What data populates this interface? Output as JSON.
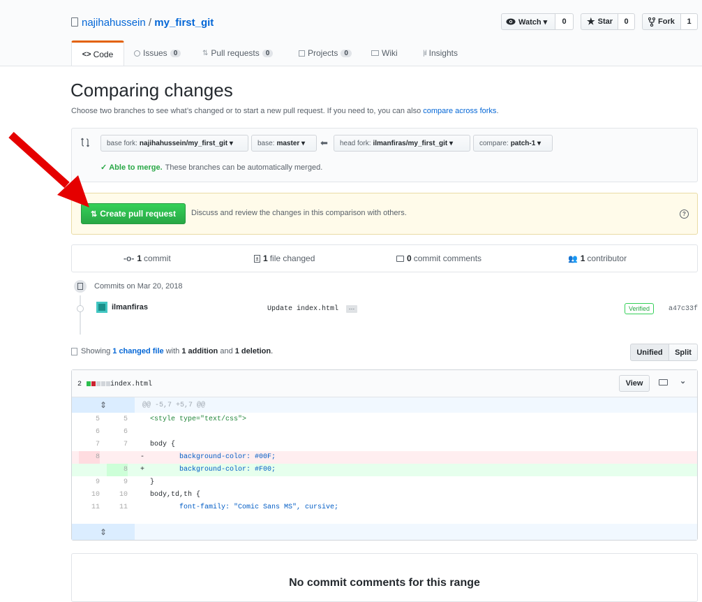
{
  "repo": {
    "owner": "najihahussein",
    "separator": " / ",
    "name": "my_first_git"
  },
  "actions": {
    "watch_label": "Watch ▾",
    "watch_count": "0",
    "star_label": "Star",
    "star_count": "0",
    "fork_label": "Fork",
    "fork_count": "1"
  },
  "tabs": [
    {
      "label": "Code",
      "count": ""
    },
    {
      "label": "Issues",
      "count": "0"
    },
    {
      "label": "Pull requests",
      "count": "0"
    },
    {
      "label": "Projects",
      "count": "0"
    },
    {
      "label": "Wiki",
      "count": ""
    },
    {
      "label": "Insights",
      "count": ""
    }
  ],
  "compare": {
    "title": "Comparing changes",
    "subtitle": "Choose two branches to see what’s changed or to start a new pull request. If you need to, you can also",
    "subtitle_link": "compare across forks",
    "subtitle_end": ".",
    "base_fork_prefix": "base fork:",
    "base_fork_value": "najihahussein/my_first_git ▾",
    "base_prefix": "base:",
    "base_value": "master ▾",
    "head_fork_prefix": "head fork:",
    "head_fork_value": "ilmanfiras/my_first_git ▾",
    "compare_prefix": "compare:",
    "compare_value": "patch-1 ▾",
    "merge_status": "Able to merge.",
    "merge_text": "These branches can be automatically merged.",
    "create_pr_label": "Create pull request",
    "create_pr_desc": "Discuss and review the changes in this comparison with others."
  },
  "summary": {
    "commits_num": "1",
    "commits_label": "commit",
    "files_num": "1",
    "files_label": "file changed",
    "comments_num": "0",
    "comments_label": "commit comments",
    "contrib_num": "1",
    "contrib_label": "contributor"
  },
  "commits": {
    "date_label": "Commits on Mar 20, 2018",
    "author": "ilmanfiras",
    "message": "Update index.html",
    "ellipsis": "…",
    "verified": "Verified",
    "sha": "a47c33f"
  },
  "files": {
    "showing": "Showing",
    "changed_link": "1 changed file",
    "with": "with",
    "additions": "1 addition",
    "and": "and",
    "deletions": "1 deletion",
    "end": ".",
    "unified": "Unified",
    "split": "Split",
    "diff_count": "2",
    "filename": "index.html",
    "view_label": "View",
    "hunk_header": "@@ -5,7 +5,7 @@"
  },
  "diff_lines": [
    {
      "old": "5",
      "new": "5",
      "sign": "",
      "code": " <style type=\"text/css\">",
      "kind": "ctx"
    },
    {
      "old": "6",
      "new": "6",
      "sign": "",
      "code": "",
      "kind": "ctx"
    },
    {
      "old": "7",
      "new": "7",
      "sign": "",
      "code": " body {",
      "kind": "ctx"
    },
    {
      "old": "8",
      "new": "",
      "sign": "-",
      "code": "        background-color: #00F;",
      "kind": "del"
    },
    {
      "old": "",
      "new": "8",
      "sign": "+",
      "code": "        background-color: #F00;",
      "kind": "add"
    },
    {
      "old": "9",
      "new": "9",
      "sign": "",
      "code": " }",
      "kind": "ctx"
    },
    {
      "old": "10",
      "new": "10",
      "sign": "",
      "code": " body,td,th {",
      "kind": "ctx"
    },
    {
      "old": "11",
      "new": "11",
      "sign": "",
      "code": "        font-family: \"Comic Sans MS\", cursive;",
      "kind": "ctx"
    }
  ],
  "comments_empty": "No commit comments for this range",
  "colors": {
    "green": "#28a745",
    "arrow": "#e50000",
    "link": "#0366d6",
    "del_bg": "#ffeef0",
    "add_bg": "#e6ffed",
    "hunk_bg": "#f1f8ff"
  },
  "icons": [
    "repo-icon",
    "eye-icon",
    "star-icon",
    "fork-icon",
    "code-icon",
    "issue-icon",
    "pr-icon",
    "project-icon",
    "wiki-icon",
    "graph-icon",
    "compare-icon",
    "check-icon",
    "question-icon",
    "commit-icon",
    "diff-icon",
    "comment-icon",
    "people-icon",
    "file-icon",
    "desktop-icon",
    "chevron-down-icon",
    "unfold-icon"
  ]
}
